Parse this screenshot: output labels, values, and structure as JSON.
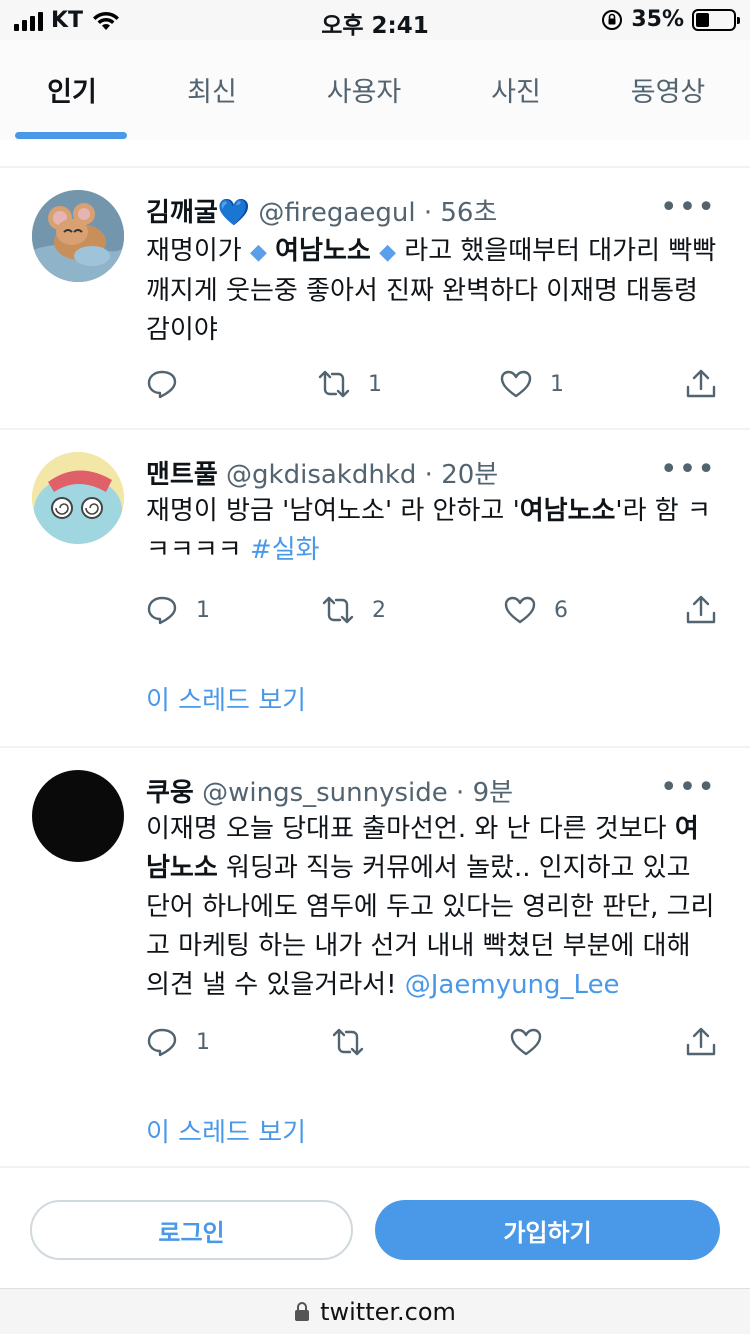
{
  "status_bar": {
    "carrier": "KT",
    "time": "오후 2:41",
    "battery": "35%",
    "battery_level": 0.35
  },
  "tabs": [
    {
      "label": "인기",
      "active": true
    },
    {
      "label": "최신",
      "active": false
    },
    {
      "label": "사용자",
      "active": false
    },
    {
      "label": "사진",
      "active": false
    },
    {
      "label": "동영상",
      "active": false
    }
  ],
  "tweets": [
    {
      "name": "김깨굴",
      "name_emoji": "💙",
      "handle": "@firegaegul",
      "sep": "·",
      "time": "56초",
      "text": {
        "p1": "재명이가",
        "bold": "여남노소",
        "p2": "라고 했을때부터 대가리 빡빡 깨지게 웃는중 좋아서 진짜 완벽하다 이재명 대통령감이야"
      },
      "counts": {
        "reply": "",
        "retweet": "1",
        "like": "1"
      }
    },
    {
      "name": "맨트풀",
      "handle": "@gkdisakdhkd",
      "sep": "·",
      "time": "20분",
      "text": {
        "p1": "재명이 방금 '남여노소' 라 안하고 '",
        "bold": "여남노소",
        "p2": "'라 함 ㅋㅋㅋㅋㅋ",
        "hashtag": "#실화"
      },
      "counts": {
        "reply": "1",
        "retweet": "2",
        "like": "6"
      },
      "thread": "이 스레드 보기"
    },
    {
      "name": "쿠웅",
      "handle": "@wings_sunnyside",
      "sep": "·",
      "time": "9분",
      "text": {
        "p1": "이재명 오늘 당대표 출마선언. 와 난 다른 것보다 ",
        "bold": "여남노소",
        "p2": " 워딩과 직능 커뮤에서 놀랐.. 인지하고 있고 단어 하나에도 염두에 두고 있다는 영리한 판단, 그리고 마케팅 하는 내가 선거 내내 빡쳤던 부분에 대해 의견 낼 수 있을거라서!",
        "mention": "@Jaemyung_Lee"
      },
      "counts": {
        "reply": "1",
        "retweet": "",
        "like": ""
      },
      "thread": "이 스레드 보기"
    }
  ],
  "bottom": {
    "login": "로그인",
    "signup": "가입하기"
  },
  "url": "twitter.com",
  "colors": {
    "accent": "#4a99e9",
    "secondary_text": "#536471",
    "divider": "#eff3f4"
  }
}
